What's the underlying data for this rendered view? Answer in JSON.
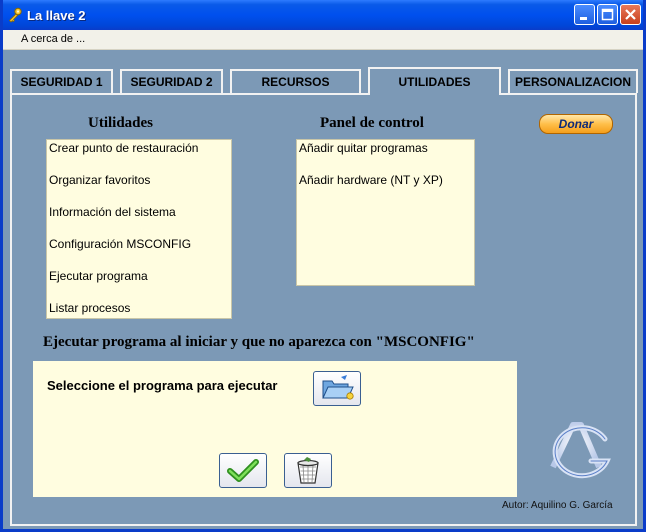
{
  "window": {
    "title": "La llave 2",
    "app_icon": "key-icon"
  },
  "menu": {
    "items": [
      "A cerca de ..."
    ]
  },
  "tabs": [
    {
      "label": "SEGURIDAD 1",
      "active": false
    },
    {
      "label": "SEGURIDAD 2",
      "active": false
    },
    {
      "label": "RECURSOS",
      "active": false
    },
    {
      "label": "UTILIDADES",
      "active": true
    },
    {
      "label": "PERSONALIZACION",
      "active": false
    }
  ],
  "utilidades": {
    "heading": "Utilidades",
    "items": [
      "Crear punto de restauración",
      "Organizar favoritos",
      "Información del sistema",
      "Configuración MSCONFIG",
      "Ejecutar programa",
      "Listar procesos"
    ]
  },
  "panel_control": {
    "heading": "Panel de control",
    "items": [
      "Añadir quitar programas",
      "Añadir hardware (NT y XP)"
    ]
  },
  "donate": {
    "label": "Donar"
  },
  "startup": {
    "heading": "Ejecutar programa al iniciar y que no aparezca con \"MSCONFIG\"",
    "select_label": "Seleccione el programa para ejecutar",
    "browse_icon": "open-folder-icon",
    "accept_icon": "green-check-icon",
    "delete_icon": "recycle-bin-icon"
  },
  "author": "Autor: Aquilino G. García",
  "logo": "ag-logo",
  "colors": {
    "title_blue": "#0a3cc9",
    "panel_bg": "#7c99b6",
    "list_bg": "#fffde0",
    "donate_orange": "#ffbf4a"
  }
}
